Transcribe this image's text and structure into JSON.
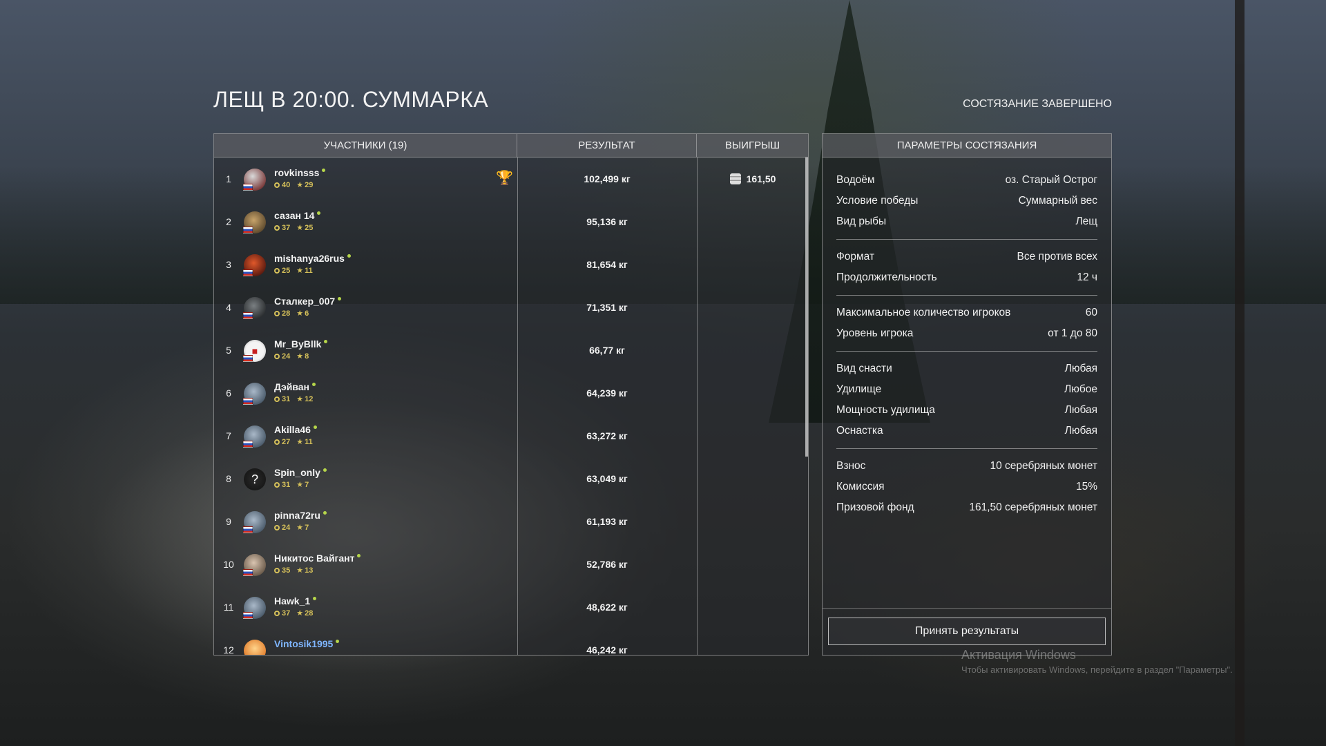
{
  "header": {
    "title": "ЛЕЩ В 20:00. СУММАРКА",
    "status": "СОСТЯЗАНИЕ ЗАВЕРШЕНО"
  },
  "table": {
    "col_participants": "УЧАСТНИКИ (19)",
    "col_result": "РЕЗУЛЬТАТ",
    "col_prize": "ВЫИГРЫШ",
    "rows": [
      {
        "rank": "1",
        "name": "rovkinsss",
        "level": "40",
        "stars": "29",
        "result": "102,499 кг",
        "prize": "161,50",
        "avatar": "helmet-avatar"
      },
      {
        "rank": "2",
        "name": "сазан 14",
        "level": "37",
        "stars": "25",
        "result": "95,136 кг",
        "prize": "",
        "avatar": "angler-avatar"
      },
      {
        "rank": "3",
        "name": "mishanya26rus",
        "level": "25",
        "stars": "11",
        "result": "81,654 кг",
        "prize": "",
        "avatar": "spider-avatar"
      },
      {
        "rank": "4",
        "name": "Сталкер_007",
        "level": "28",
        "stars": "6",
        "result": "71,351 кг",
        "prize": "",
        "avatar": "stalker-avatar"
      },
      {
        "rank": "5",
        "name": "Mr_ByBllk",
        "level": "24",
        "stars": "8",
        "result": "66,77 кг",
        "prize": "",
        "avatar": "red-face-avatar"
      },
      {
        "rank": "6",
        "name": "Дэйван",
        "level": "31",
        "stars": "12",
        "result": "64,239 кг",
        "prize": "",
        "avatar": "default-avatar"
      },
      {
        "rank": "7",
        "name": "Akilla46",
        "level": "27",
        "stars": "11",
        "result": "63,272 кг",
        "prize": "",
        "avatar": "default-avatar"
      },
      {
        "rank": "8",
        "name": "Spin_only",
        "level": "31",
        "stars": "7",
        "result": "63,049 кг",
        "prize": "",
        "avatar": "question-avatar"
      },
      {
        "rank": "9",
        "name": "pinna72ru",
        "level": "24",
        "stars": "7",
        "result": "61,193 кг",
        "prize": "",
        "avatar": "default-avatar"
      },
      {
        "rank": "10",
        "name": "Никитос Вайгант",
        "level": "35",
        "stars": "13",
        "result": "52,786 кг",
        "prize": "",
        "avatar": "photo-avatar"
      },
      {
        "rank": "11",
        "name": "Hawk_1",
        "level": "37",
        "stars": "28",
        "result": "48,622 кг",
        "prize": "",
        "avatar": "default-avatar"
      },
      {
        "rank": "12",
        "name": "Vintosik1995",
        "level": "",
        "stars": "",
        "result": "46,242 кг",
        "prize": "",
        "avatar": "sunset-avatar",
        "highlight": true
      }
    ]
  },
  "params": {
    "title": "ПАРАМЕТРЫ СОСТЯЗАНИЯ",
    "groups": [
      [
        {
          "label": "Водоём",
          "value": "оз. Старый Острог"
        },
        {
          "label": "Условие победы",
          "value": "Суммарный вес"
        },
        {
          "label": "Вид рыбы",
          "value": "Лещ"
        }
      ],
      [
        {
          "label": "Формат",
          "value": "Все против всех"
        },
        {
          "label": "Продолжительность",
          "value": "12 ч"
        }
      ],
      [
        {
          "label": "Максимальное количество игроков",
          "value": "60"
        },
        {
          "label": "Уровень игрока",
          "value": "от 1 до 80"
        }
      ],
      [
        {
          "label": "Вид снасти",
          "value": "Любая"
        },
        {
          "label": "Удилище",
          "value": "Любое"
        },
        {
          "label": "Мощность удилища",
          "value": "Любая"
        },
        {
          "label": "Оснастка",
          "value": "Любая"
        }
      ],
      [
        {
          "label": "Взнос",
          "value": "10 серебряных монет"
        },
        {
          "label": "Комиссия",
          "value": "15%"
        },
        {
          "label": "Призовой фонд",
          "value": "161,50 серебряных монет"
        }
      ]
    ],
    "accept_label": "Принять результаты"
  },
  "watermark": {
    "line1": "Активация Windows",
    "line2": "Чтобы активировать Windows, перейдите в раздел \"Параметры\"."
  }
}
